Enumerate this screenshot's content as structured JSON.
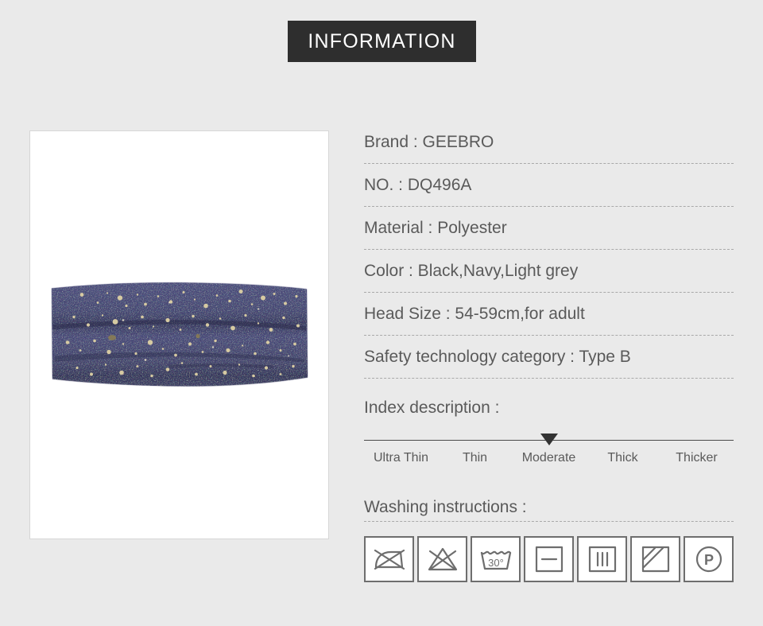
{
  "header": {
    "title": "INFORMATION"
  },
  "product_image": {
    "alt": "navy headband with gold speckles",
    "fabric_color": "#4a4b78",
    "fabric_color_dark": "#33345c",
    "speckle_color": "#cfc39a",
    "background": "#ffffff"
  },
  "specs": [
    {
      "label": "Brand",
      "value": "GEEBRO",
      "text": "Brand : GEEBRO"
    },
    {
      "label": "NO.",
      "value": "DQ496A",
      "text": "NO. : DQ496A"
    },
    {
      "label": "Material",
      "value": "Polyester",
      "text": "Material : Polyester"
    },
    {
      "label": "Color",
      "value": "Black,Navy,Light grey",
      "text": "Color : Black,Navy,Light grey"
    },
    {
      "label": "Head Size",
      "value": "54-59cm,for adult",
      "text": "Head Size : 54-59cm,for adult"
    },
    {
      "label": "Safety technology category",
      "value": "Type B",
      "text": "Safety technology category : Type B"
    }
  ],
  "index": {
    "heading": "Index description :",
    "levels": [
      "Ultra Thin",
      "Thin",
      "Moderate",
      "Thick",
      "Thicker"
    ],
    "selected": "Moderate",
    "selected_index": 2,
    "marker_position_percent": 50
  },
  "washing": {
    "heading": "Washing instructions :",
    "icons": [
      {
        "name": "do-not-iron-icon",
        "label": "Do not iron"
      },
      {
        "name": "do-not-bleach-icon",
        "label": "Do not bleach"
      },
      {
        "name": "machine-wash-30-icon",
        "label": "Machine wash at 30°",
        "temperature": "30°"
      },
      {
        "name": "dry-flat-icon",
        "label": "Dry flat"
      },
      {
        "name": "drip-dry-icon",
        "label": "Drip dry"
      },
      {
        "name": "dry-in-shade-icon",
        "label": "Dry in shade"
      },
      {
        "name": "dry-clean-p-icon",
        "label": "Dry clean with perchloroethylene",
        "letter": "P"
      }
    ]
  },
  "theme": {
    "page_background": "#eaeaea",
    "banner_background": "#2e2e2e",
    "banner_text": "#ffffff",
    "text_color": "#5a5a5a",
    "divider_color": "#a9a9a9",
    "icon_stroke": "#6e6e6e",
    "marker_color": "#333333"
  }
}
